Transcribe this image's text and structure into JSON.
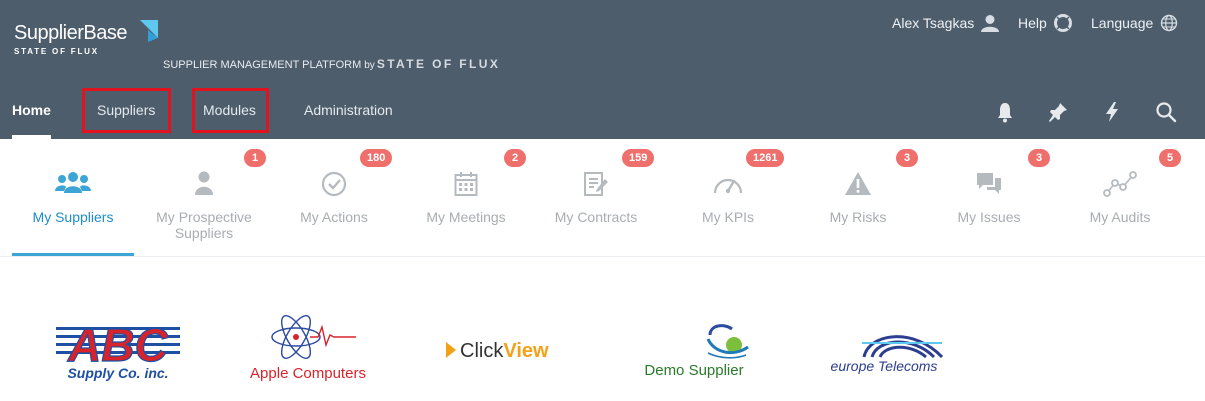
{
  "brand": {
    "name": "SupplierBase",
    "sub": "STATE OF FLUX",
    "platform_text": "SUPPLIER MANAGEMENT PLATFORM",
    "by_text": "by",
    "platform_brand": "STATE OF FLUX"
  },
  "user_menu": {
    "user_name": "Alex Tsagkas",
    "help_label": "Help",
    "language_label": "Language"
  },
  "nav": {
    "items": [
      {
        "label": "Home",
        "active": true
      },
      {
        "label": "Suppliers",
        "highlighted": true
      },
      {
        "label": "Modules",
        "highlighted": true
      },
      {
        "label": "Administration"
      }
    ],
    "icons": [
      "bell-icon",
      "pin-icon",
      "lightning-icon",
      "search-icon"
    ]
  },
  "tiles": [
    {
      "label": "My Suppliers",
      "icon": "users-icon",
      "badge": null,
      "active": true
    },
    {
      "label": "My Prospective Suppliers",
      "icon": "user-icon",
      "badge": "1"
    },
    {
      "label": "My Actions",
      "icon": "check-circle-icon",
      "badge": "180"
    },
    {
      "label": "My Meetings",
      "icon": "calendar-icon",
      "badge": "2"
    },
    {
      "label": "My Contracts",
      "icon": "contract-icon",
      "badge": "159"
    },
    {
      "label": "My KPIs",
      "icon": "gauge-icon",
      "badge": "1261"
    },
    {
      "label": "My Risks",
      "icon": "warning-icon",
      "badge": "3"
    },
    {
      "label": "My Issues",
      "icon": "chat-icon",
      "badge": "3"
    },
    {
      "label": "My Audits",
      "icon": "audit-icon",
      "badge": "5"
    }
  ],
  "suppliers": [
    {
      "name": "ABC",
      "tagline": "Supply Co. inc."
    },
    {
      "name": "Apple Computers"
    },
    {
      "name": "ClickView",
      "part1": "Click",
      "part2": "View"
    },
    {
      "name": "Demo Supplier"
    },
    {
      "name": "europe Telecoms"
    }
  ],
  "colors": {
    "header_bg": "#4e5d6c",
    "accent": "#1f8dc8",
    "badge": "#ef6f6c",
    "highlight": "#e0141e"
  }
}
